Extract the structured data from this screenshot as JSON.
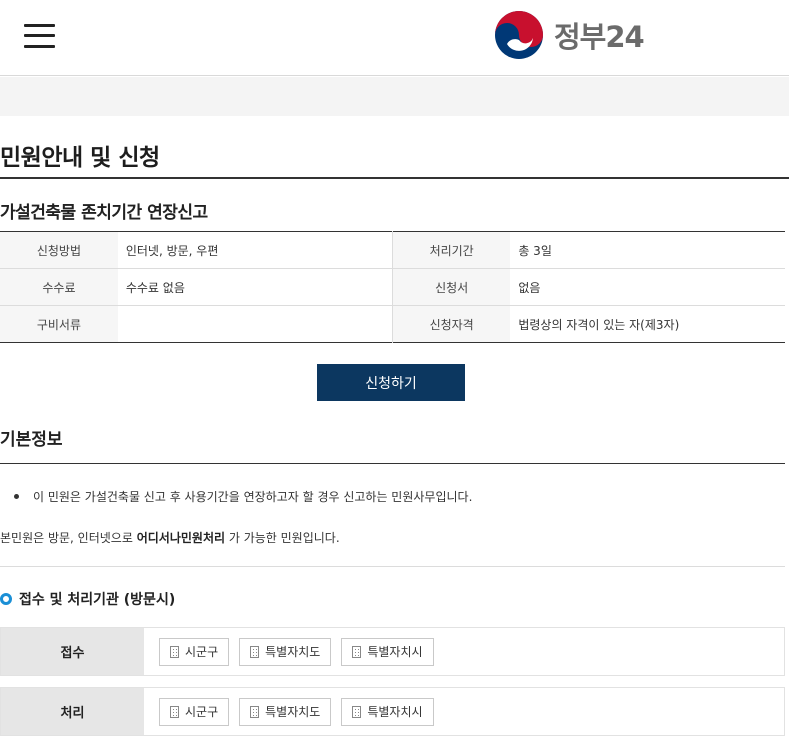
{
  "header": {
    "logo_text": "정부24",
    "menu_icon": "hamburger-menu-icon",
    "logo_icon": "taegeuk-logo-icon"
  },
  "page": {
    "title": "민원안내 및 신청",
    "service_name": "가설건축물 존치기간 연장신고"
  },
  "info": {
    "rows": [
      {
        "label1": "신청방법",
        "value1": "인터넷, 방문, 우편",
        "label2": "처리기간",
        "value2": "총 3일"
      },
      {
        "label1": "수수료",
        "value1": "수수료 없음",
        "label2": "신청서",
        "value2": "없음"
      },
      {
        "label1": "구비서류",
        "value1": "",
        "label2": "신청자격",
        "value2": "법령상의 자격이 있는 자(제3자)"
      }
    ]
  },
  "apply_button": "신청하기",
  "basic_info": {
    "title": "기본정보",
    "bullet": "이 민원은 가설건축물 신고 후 사용기간을 연장하고자 할 경우 신고하는 민원사무입니다.",
    "note_prefix": "본민원은 방문, 인터넷으로 ",
    "note_bold": "어디서나민원처리",
    "note_suffix": " 가 가능한 민원입니다."
  },
  "agency": {
    "title": "접수 및 처리기관 (방문시)",
    "rows": [
      {
        "label": "접수",
        "buttons": [
          "시군구",
          "특별자치도",
          "특별자치시"
        ]
      },
      {
        "label": "처리",
        "buttons": [
          "시군구",
          "특별자치도",
          "특별자치시"
        ]
      }
    ]
  },
  "colors": {
    "primary_button": "#0c3760",
    "accent_ring": "#1a8fd6",
    "logo_red": "#c8102e",
    "logo_blue": "#003876"
  }
}
